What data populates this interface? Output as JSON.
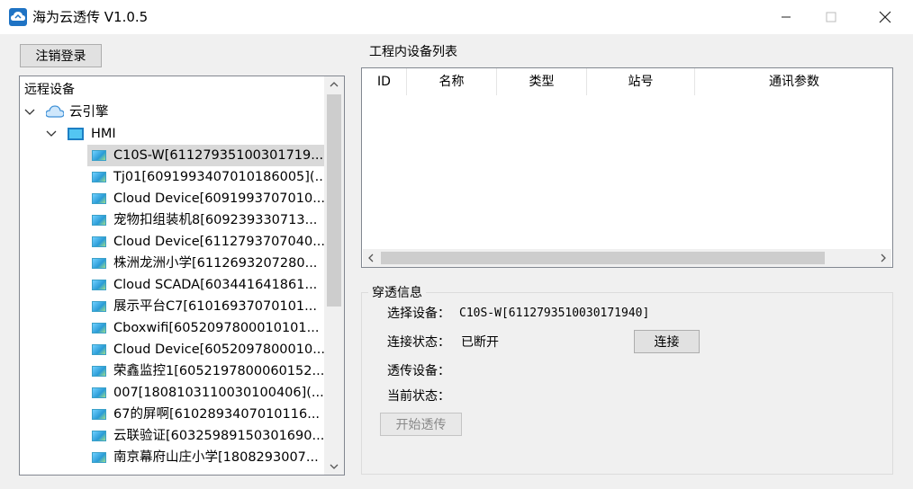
{
  "window": {
    "title": "海为云透传 V1.0.5",
    "controls": [
      "minimize",
      "maximize",
      "close"
    ]
  },
  "left": {
    "logout_label": "注销登录",
    "tree_header": "远程设备",
    "root": {
      "label": "云引擎",
      "icon": "cloud-icon"
    },
    "group": {
      "label": "HMI",
      "icon": "hmi-icon"
    },
    "devices": [
      "C10S-W[61127935100301719...",
      "Tj01[6091993407010186005](...",
      "Cloud Device[6091993707010...",
      "宠物扣组装机8[609239330713...",
      "Cloud Device[6112793707040...",
      "株洲龙洲小学[6112693207280...",
      "Cloud SCADA[603441641861...",
      "展示平台C7[61016937070101...",
      "Cboxwifi[6052097800010101...",
      "Cloud Device[6052097800010...",
      "荣鑫监控1[6052197800060152...",
      "007[1808103110030100406](...",
      "67的屏啊[6102893407010116...",
      "云联验证[60325989150301690...",
      "南京幕府山庄小学[1808293007..."
    ],
    "selected_index": 0
  },
  "right": {
    "table_title": "工程内设备列表",
    "columns": [
      "ID",
      "名称",
      "类型",
      "站号",
      "通讯参数"
    ],
    "rows": [],
    "group_title": "穿透信息",
    "select_device_label": "选择设备：",
    "select_device_value": "C10S-W[6112793510030171940]",
    "connect_status_label": "连接状态：",
    "connect_status_value": "已断开",
    "connect_button": "连接",
    "passthrough_device_label": "透传设备：",
    "current_status_label": "当前状态：",
    "start_button": "开始透传"
  },
  "colors": {
    "accent": "#1f73c4",
    "selected_row": "#d9d9d9",
    "disabled_text": "#8a8a8a"
  }
}
